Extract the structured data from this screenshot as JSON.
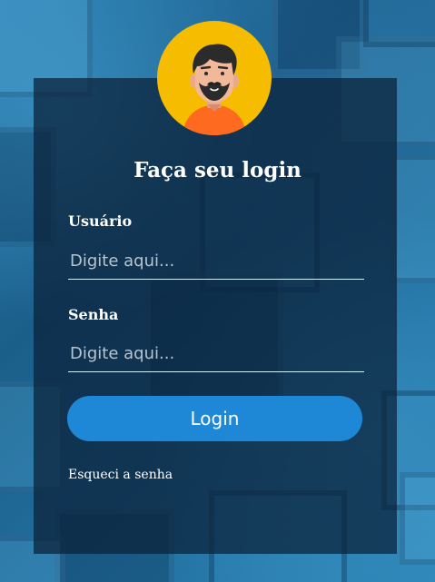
{
  "login": {
    "title": "Faça seu login",
    "username_label": "Usuário",
    "username_placeholder": "Digite aqui...",
    "username_value": "",
    "password_label": "Senha",
    "password_placeholder": "Digite aqui...",
    "password_value": "",
    "submit_label": "Login",
    "forgot_link": "Esqueci a senha"
  },
  "icons": {
    "avatar": "user-avatar-icon"
  },
  "colors": {
    "accent": "#1e88d6",
    "avatar_bg": "#f6bd00",
    "card_bg": "#0a2037",
    "text": "#ffffff"
  }
}
